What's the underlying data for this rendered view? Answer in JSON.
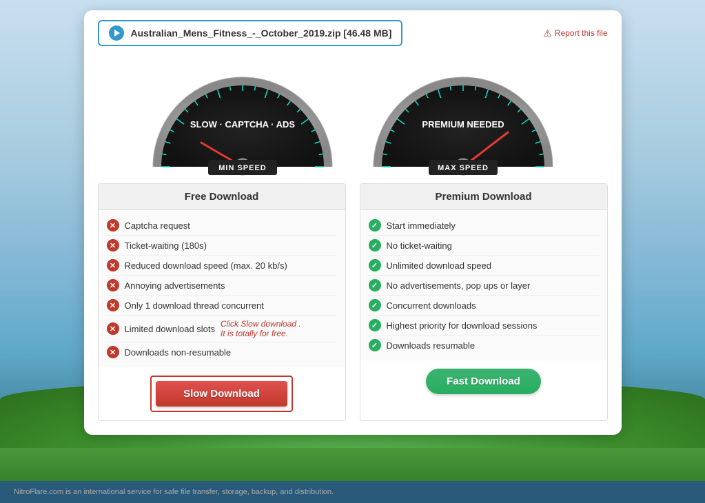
{
  "background": {
    "footer_text": "NitroFlare.com is an international service for safe file transfer, storage, backup, and distribution."
  },
  "file_header": {
    "file_name": "Australian_Mens_Fitness_-_October_2019.zip [46.48 MB]",
    "report_label": "Report this file"
  },
  "speedometers": [
    {
      "id": "free",
      "label1": "SLOW · CAPTCHA · ADS",
      "label2": "MIN SPEED"
    },
    {
      "id": "premium",
      "label1": "PREMIUM NEEDED",
      "label2": "MAX SPEED"
    }
  ],
  "free_panel": {
    "header": "Free Download",
    "features": [
      "Captcha request",
      "Ticket-waiting (180s)",
      "Reduced download speed (max. 20 kb/s)",
      "Annoying advertisements",
      "Only 1 download thread concurrent",
      "Limited download slots",
      "Downloads non-resumable"
    ]
  },
  "premium_panel": {
    "header": "Premium Download",
    "features": [
      "Start immediately",
      "No ticket-waiting",
      "Unlimited download speed",
      "No advertisements, pop ups or layer",
      "Concurrent downloads",
      "Highest priority for download sessions",
      "Downloads resumable"
    ]
  },
  "buttons": {
    "slow_download": "Slow Download",
    "fast_download": "Fast Download",
    "click_hint_line1": "Click Slow download .",
    "click_hint_line2": "It is totally for free."
  }
}
